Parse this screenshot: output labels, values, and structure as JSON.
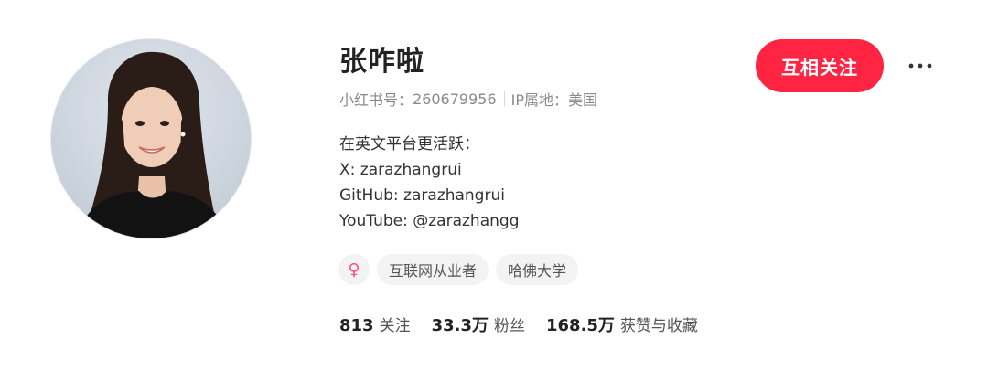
{
  "profile": {
    "name": "张咋啦",
    "account_label": "小红书号：",
    "account_id": "260679956",
    "ip_label": "IP属地：",
    "ip_location": "美国",
    "bio_lines": [
      "在英文平台更活跃：",
      "X: zarazhangrui",
      "GitHub: zarazhangrui",
      "YouTube: @zarazhangg"
    ],
    "tags": [
      {
        "icon": "female-icon",
        "symbol": "♀"
      },
      {
        "label": "互联网从业者"
      },
      {
        "label": "哈佛大学"
      }
    ]
  },
  "stats": [
    {
      "value": "813",
      "label": "关注"
    },
    {
      "value": "33.3万",
      "label": "粉丝"
    },
    {
      "value": "168.5万",
      "label": "获赞与收藏"
    }
  ],
  "actions": {
    "follow_label": "互相关注",
    "more_icon": "more-dots-icon"
  },
  "colors": {
    "accent": "#ff2442",
    "female_pink": "#ff4d7a",
    "secondary_text": "#8a8a8a"
  }
}
